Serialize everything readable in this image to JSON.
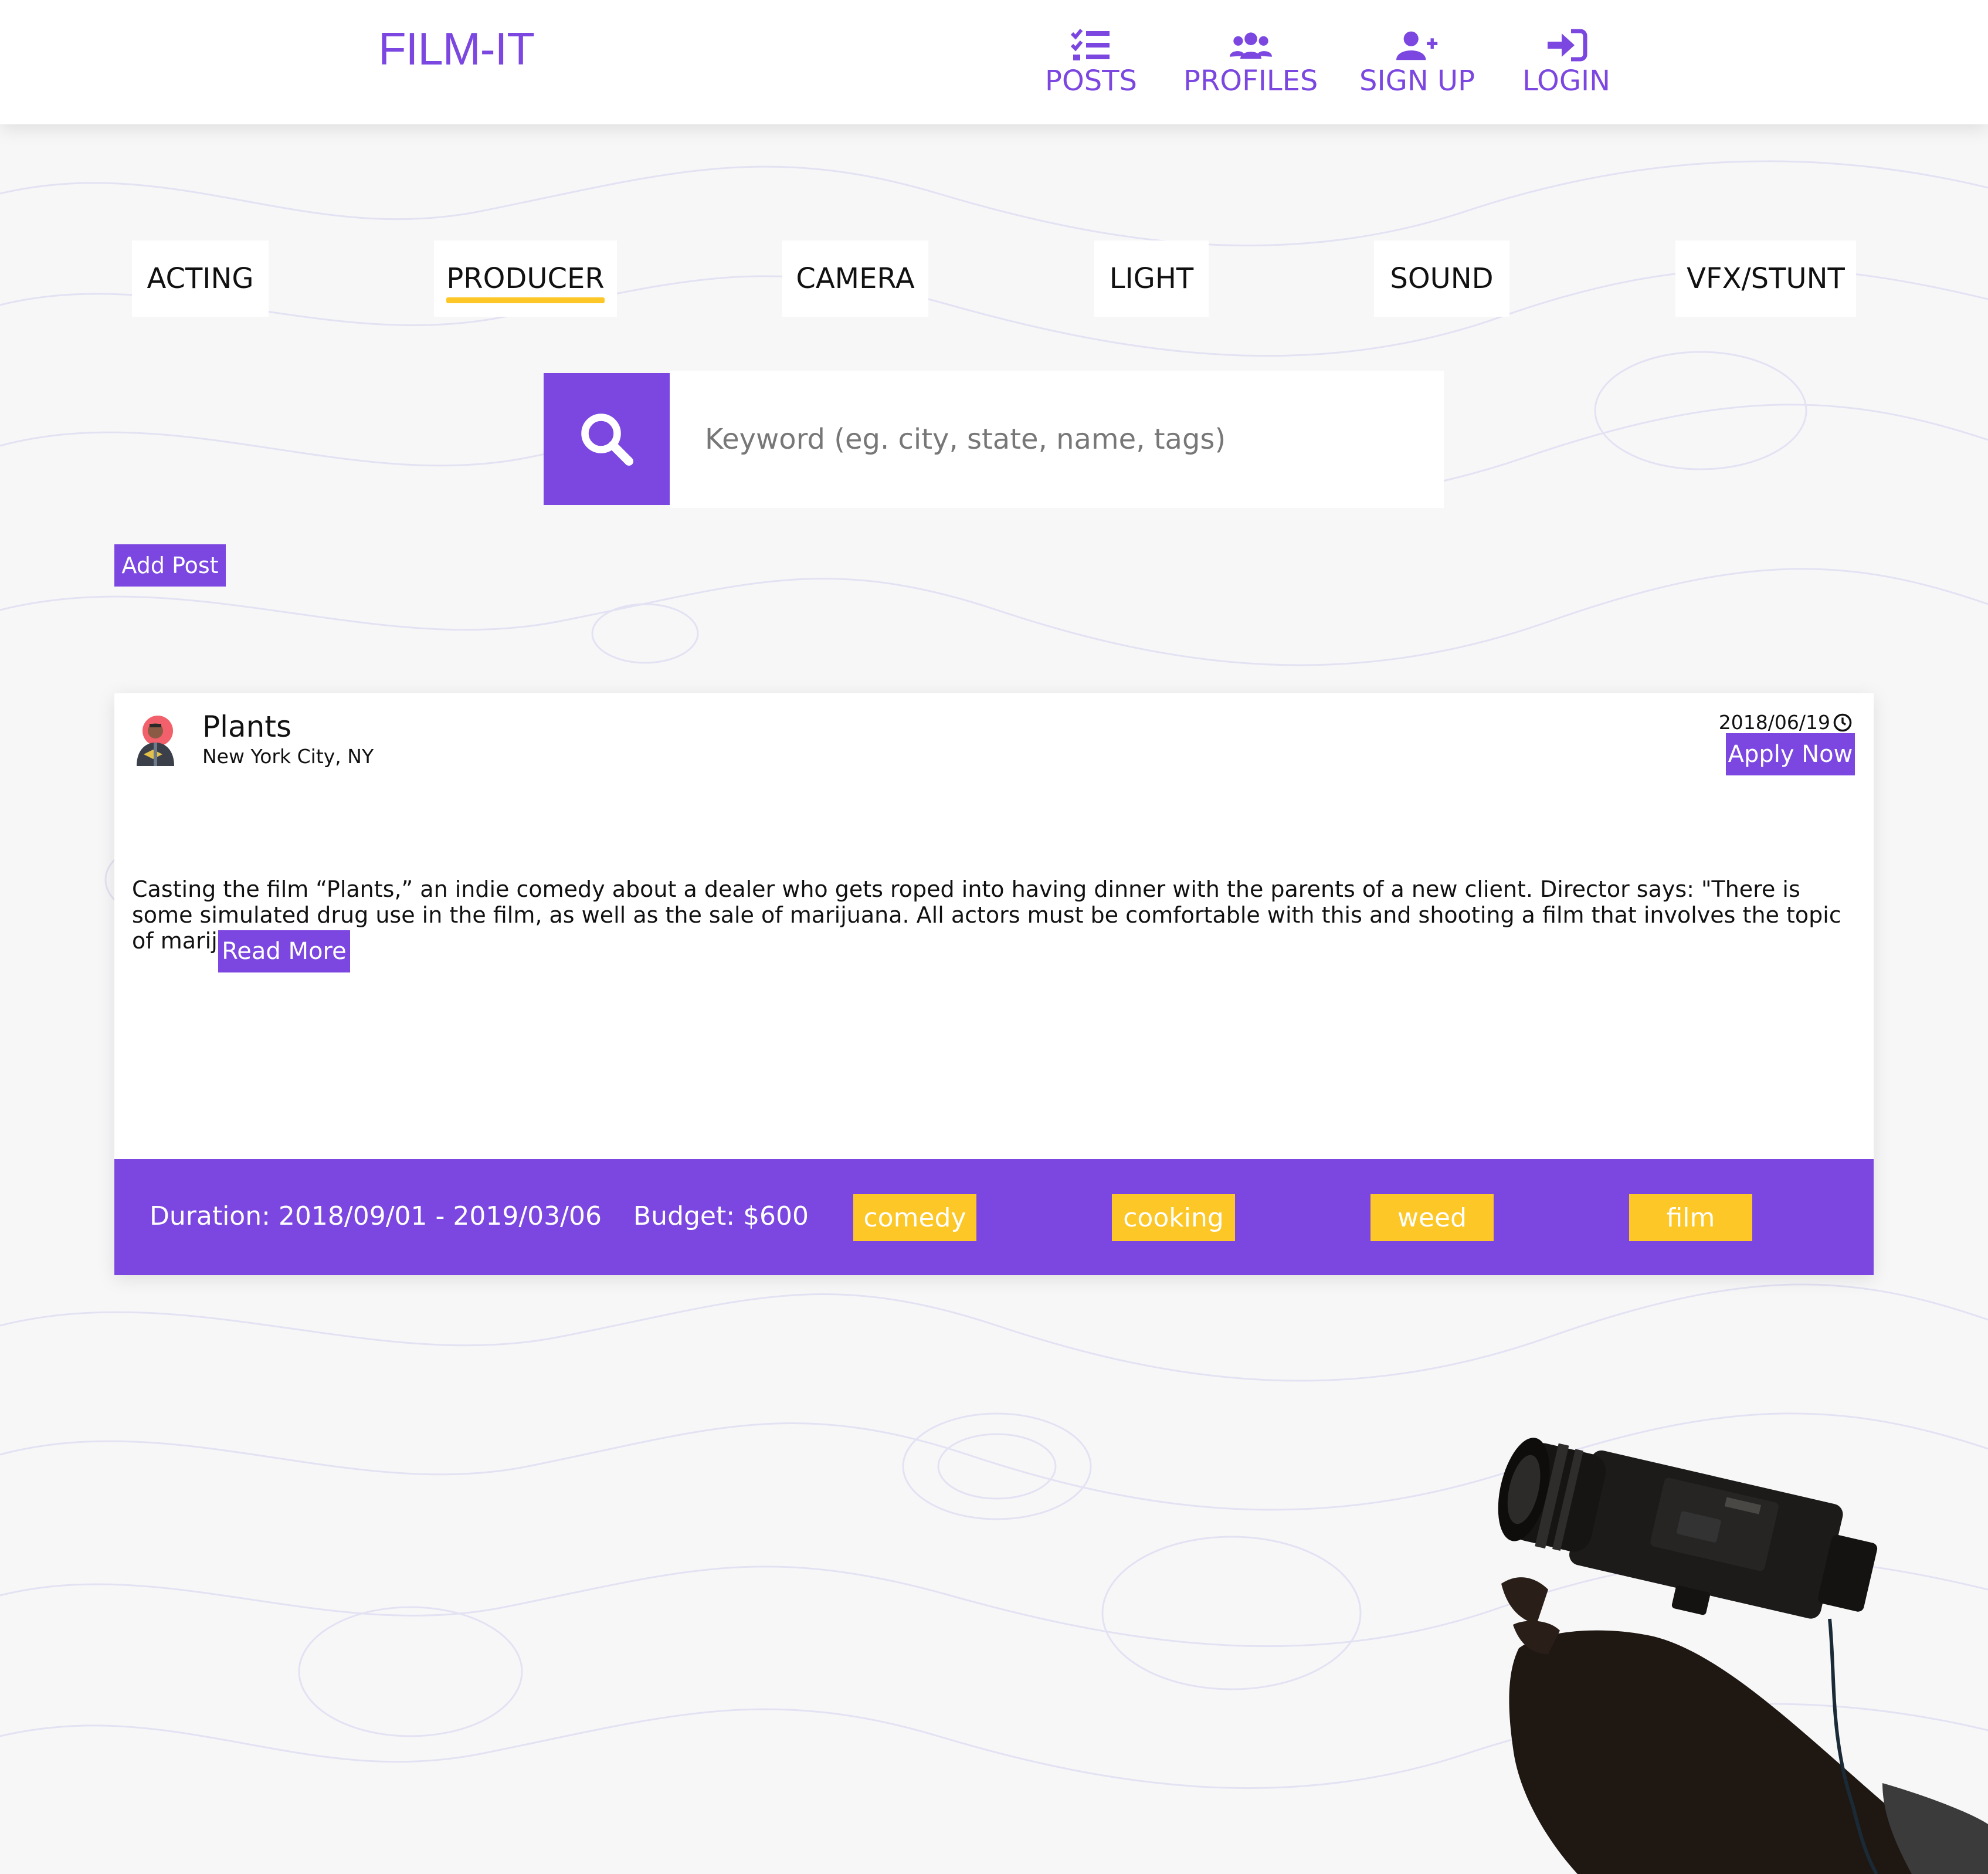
{
  "header": {
    "logo": "FILM-IT",
    "nav": [
      {
        "label": "POSTS",
        "icon": "tasks-list-icon"
      },
      {
        "label": "PROFILES",
        "icon": "users-icon"
      },
      {
        "label": "SIGN UP",
        "icon": "user-plus-icon"
      },
      {
        "label": "LOGIN",
        "icon": "sign-in-icon"
      }
    ]
  },
  "categories": {
    "tabs": [
      "ACTING",
      "PRODUCER",
      "CAMERA",
      "LIGHT",
      "SOUND",
      "VFX/STUNT"
    ],
    "active": "PRODUCER"
  },
  "search": {
    "placeholder": "Keyword (eg. city, state, name, tags)",
    "value": "",
    "icon": "search-icon"
  },
  "actions": {
    "add_post_label": "Add Post"
  },
  "post": {
    "title": "Plants",
    "location": "New York City, NY",
    "date": "2018/06/19",
    "apply_label": "Apply Now",
    "description": "Casting the film “Plants,” an indie comedy about a dealer who gets roped into having dinner with the parents of a new client. Director says: \"There is some simulated drug use in the film, as well as the sale of marijuana. All actors must be comfortable with this and shooting a film that involves the topic of marijuana.\"",
    "read_more_label": "Read More",
    "duration": "Duration: 2018/09/01 - 2019/03/06",
    "budget": "Budget: $600",
    "tags": [
      "comedy",
      "cooking",
      "weed",
      "film"
    ]
  },
  "colors": {
    "accent": "#7b47e0",
    "tag": "#fcc727",
    "background": "#f7f7f8"
  }
}
